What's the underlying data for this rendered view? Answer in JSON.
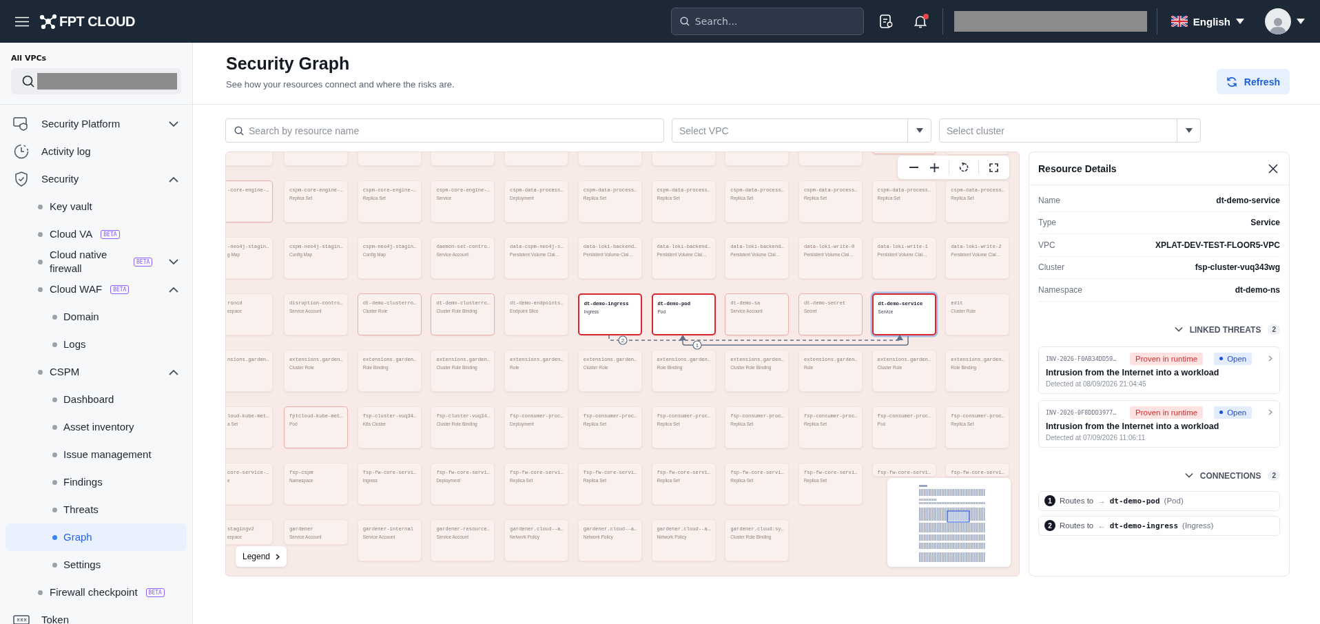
{
  "header": {
    "logo": "FPT CLOUD",
    "search": {
      "placeholder": "Search..."
    },
    "notifications": {
      "unread": true
    },
    "language": "English"
  },
  "sidebar": {
    "scope_label": "All VPCs",
    "items": [
      {
        "label": "Security Platform",
        "expanded": false,
        "selected": false
      },
      {
        "label": "Activity log",
        "selected": false
      },
      {
        "label": "Security",
        "expanded": true,
        "selected": false,
        "children": [
          {
            "label": "Key vault",
            "selected": false
          },
          {
            "label": "Cloud VA",
            "badge": "BETA",
            "selected": false
          },
          {
            "label": "Cloud native firewall",
            "badge": "BETA",
            "expanded": false,
            "selected": false
          },
          {
            "label": "Cloud WAF",
            "badge": "BETA",
            "expanded": true,
            "selected": false,
            "children": [
              {
                "label": "Domain",
                "selected": false
              },
              {
                "label": "Logs",
                "selected": false
              }
            ]
          },
          {
            "label": "CSPM",
            "expanded": true,
            "selected": false,
            "children": [
              {
                "label": "Dashboard",
                "selected": false
              },
              {
                "label": "Asset inventory",
                "selected": false
              },
              {
                "label": "Issue management",
                "selected": false
              },
              {
                "label": "Findings",
                "selected": false
              },
              {
                "label": "Threats",
                "selected": false
              },
              {
                "label": "Graph",
                "selected": true
              },
              {
                "label": "Settings",
                "selected": false
              }
            ]
          },
          {
            "label": "Firewall checkpoint",
            "badge": "BETA",
            "selected": false
          }
        ]
      },
      {
        "label": "Token",
        "selected": false
      }
    ]
  },
  "page": {
    "title": "Security Graph",
    "subtitle": "See how your resources connect and where the risks are.",
    "refresh": "Refresh"
  },
  "filters": {
    "search": {
      "placeholder": "Search by resource name"
    },
    "vpc": {
      "placeholder": "Select VPC"
    },
    "cluster": {
      "placeholder": "Select cluster"
    }
  },
  "graph": {
    "rows": [
      {
        "nodes": [
          {
            "risk": false,
            "in_path": false,
            "selected": false
          },
          {
            "risk": false,
            "in_path": false,
            "selected": false
          },
          {
            "risk": false,
            "in_path": false,
            "selected": false
          },
          {
            "risk": false,
            "in_path": false,
            "selected": false
          },
          {
            "risk": false,
            "in_path": false,
            "selected": false
          },
          {
            "risk": false,
            "in_path": false,
            "selected": false
          },
          {
            "risk": false,
            "in_path": false,
            "selected": false
          },
          {
            "risk": false,
            "in_path": false,
            "selected": false
          },
          {
            "risk": false,
            "in_path": false,
            "selected": false
          },
          {
            "risk": true,
            "in_path": false,
            "selected": false
          },
          {
            "risk": false,
            "in_path": false,
            "selected": false
          }
        ]
      },
      {
        "nodes": [
          {
            "name": "-core-engine-…",
            "risk": true,
            "in_path": false,
            "selected": false
          },
          {
            "name": "cspm-core-engine-…",
            "type": "Replica Set",
            "risk": false,
            "in_path": false,
            "selected": false
          },
          {
            "name": "cspm-core-engine-…",
            "type": "Replica Set",
            "risk": false,
            "in_path": false,
            "selected": false
          },
          {
            "name": "cspm-core-engine-…",
            "type": "Service",
            "risk": false,
            "in_path": false,
            "selected": false
          },
          {
            "name": "cspm-data-process…",
            "type": "Deployment",
            "risk": false,
            "in_path": false,
            "selected": false
          },
          {
            "name": "cspm-data-process…",
            "type": "Replica Set",
            "risk": false,
            "in_path": false,
            "selected": false
          },
          {
            "name": "cspm-data-process…",
            "type": "Replica Set",
            "risk": false,
            "in_path": false,
            "selected": false
          },
          {
            "name": "cspm-data-process…",
            "type": "Replica Set",
            "risk": false,
            "in_path": false,
            "selected": false
          },
          {
            "name": "cspm-data-process…",
            "type": "Replica Set",
            "risk": false,
            "in_path": false,
            "selected": false
          },
          {
            "name": "cspm-data-process…",
            "type": "Replica Set",
            "risk": false,
            "in_path": false,
            "selected": false
          },
          {
            "name": "cspm-data-process…",
            "type": "Replica Set",
            "risk": false,
            "in_path": false,
            "selected": false
          }
        ]
      },
      {
        "nodes": [
          {
            "name": "-neo4j-stagin…",
            "type": "g Map",
            "risk": false,
            "in_path": false,
            "selected": false
          },
          {
            "name": "cspm-neo4j-stagin…",
            "type": "Config Map",
            "risk": false,
            "in_path": false,
            "selected": false
          },
          {
            "name": "cspm-neo4j-stagin…",
            "type": "Config Map",
            "risk": false,
            "in_path": false,
            "selected": false
          },
          {
            "name": "daemon-set-contro…",
            "type": "Service Account",
            "risk": false,
            "in_path": false,
            "selected": false
          },
          {
            "name": "data-cspm-neo4j-s…",
            "type": "Persistent Volume Clai…",
            "risk": false,
            "in_path": false,
            "selected": false
          },
          {
            "name": "data-loki-backend…",
            "type": "Persistent Volume Clai…",
            "risk": false,
            "in_path": false,
            "selected": false
          },
          {
            "name": "data-loki-backend…",
            "type": "Persistent Volume Clai…",
            "risk": false,
            "in_path": false,
            "selected": false
          },
          {
            "name": "data-loki-backend…",
            "type": "Persistent Volume Clai…",
            "risk": false,
            "in_path": false,
            "selected": false
          },
          {
            "name": "data-loki-write-0",
            "type": "Persistent Volume Clai…",
            "risk": false,
            "in_path": false,
            "selected": false
          },
          {
            "name": "data-loki-write-1",
            "type": "Persistent Volume Clai…",
            "risk": false,
            "in_path": false,
            "selected": false
          },
          {
            "name": "data-loki-write-2",
            "type": "Persistent Volume Clai…",
            "risk": false,
            "in_path": false,
            "selected": false
          }
        ]
      },
      {
        "nodes": [
          {
            "name": "roncd",
            "type": "espace",
            "risk": false,
            "in_path": false,
            "selected": false
          },
          {
            "name": "disruption-contro…",
            "type": "Service Account",
            "risk": false,
            "in_path": false,
            "selected": false
          },
          {
            "name": "dt-demo-clusterro…",
            "type": "Cluster Role",
            "risk": true,
            "in_path": false,
            "selected": false
          },
          {
            "name": "dt-demo-clusterro…",
            "type": "Cluster Role Binding",
            "risk": true,
            "in_path": false,
            "selected": false
          },
          {
            "name": "dt-demo-endpoints…",
            "type": "Endpoint Slice",
            "risk": false,
            "in_path": false,
            "selected": false
          },
          {
            "name": "dt-demo-ingress",
            "type": "Ingress",
            "risk": true,
            "in_path": true,
            "selected": false
          },
          {
            "name": "dt-demo-pod",
            "type": "Pod",
            "risk": true,
            "in_path": true,
            "selected": false
          },
          {
            "name": "dt-demo-sa",
            "type": "Service Account",
            "risk": true,
            "in_path": false,
            "selected": false
          },
          {
            "name": "dt-demo-secret",
            "type": "Secret",
            "risk": true,
            "in_path": false,
            "selected": false
          },
          {
            "name": "dt-demo-service",
            "type": "Service",
            "risk": true,
            "in_path": true,
            "selected": true
          },
          {
            "name": "edit",
            "type": "Cluster Role",
            "risk": false,
            "in_path": false,
            "selected": false
          }
        ]
      },
      {
        "nodes": [
          {
            "name": "nsions.garden…",
            "risk": false,
            "in_path": false,
            "selected": false
          },
          {
            "name": "extensions.garden…",
            "type": "Cluster Role",
            "risk": false,
            "in_path": false,
            "selected": false
          },
          {
            "name": "extensions.garden…",
            "type": "Role Binding",
            "risk": false,
            "in_path": false,
            "selected": false
          },
          {
            "name": "extensions.garden…",
            "type": "Cluster Role Binding",
            "risk": false,
            "in_path": false,
            "selected": false
          },
          {
            "name": "extensions.garden…",
            "type": "Role",
            "risk": false,
            "in_path": false,
            "selected": false
          },
          {
            "name": "extensions.garden…",
            "type": "Cluster Role",
            "risk": false,
            "in_path": false,
            "selected": false
          },
          {
            "name": "extensions.garden…",
            "type": "Role Binding",
            "risk": false,
            "in_path": false,
            "selected": false
          },
          {
            "name": "extensions.garden…",
            "type": "Cluster Role Binding",
            "risk": false,
            "in_path": false,
            "selected": false
          },
          {
            "name": "extensions.garden…",
            "type": "Role",
            "risk": false,
            "in_path": false,
            "selected": false
          },
          {
            "name": "extensions.garden…",
            "type": "Cluster Role",
            "risk": false,
            "in_path": false,
            "selected": false
          },
          {
            "name": "extensions.garden…",
            "type": "Role Binding",
            "risk": false,
            "in_path": false,
            "selected": false
          }
        ]
      },
      {
        "nodes": [
          {
            "name": "loud-kube-met…",
            "type": "a Set",
            "risk": false,
            "in_path": false,
            "selected": false
          },
          {
            "name": "fptcloud-kube-met…",
            "type": "Pod",
            "risk": true,
            "in_path": false,
            "selected": false
          },
          {
            "name": "fsp-cluster-vuq34…",
            "type": "K8s Cluster",
            "risk": false,
            "in_path": false,
            "selected": false
          },
          {
            "name": "fsp-cluster-vuq34…",
            "type": "Cluster Role Binding",
            "risk": false,
            "in_path": false,
            "selected": false
          },
          {
            "name": "fsp-consumer-proc…",
            "type": "Deployment",
            "risk": false,
            "in_path": false,
            "selected": false
          },
          {
            "name": "fsp-consumer-proc…",
            "type": "Replica Set",
            "risk": false,
            "in_path": false,
            "selected": false
          },
          {
            "name": "fsp-consumer-proc…",
            "type": "Replica Set",
            "risk": false,
            "in_path": false,
            "selected": false
          },
          {
            "name": "fsp-consumer-proc…",
            "type": "Replica Set",
            "risk": false,
            "in_path": false,
            "selected": false
          },
          {
            "name": "fsp-consumer-proc…",
            "type": "Replica Set",
            "risk": false,
            "in_path": false,
            "selected": false
          },
          {
            "name": "fsp-consumer-proc…",
            "type": "Pod",
            "risk": false,
            "in_path": false,
            "selected": false
          },
          {
            "name": "fsp-consumer-proc…",
            "type": "Replica Set",
            "risk": false,
            "in_path": false,
            "selected": false
          }
        ]
      },
      {
        "nodes": [
          {
            "name": "core-service-…",
            "type": "e",
            "risk": false,
            "in_path": false,
            "selected": false
          },
          {
            "name": "fsp-cspm",
            "type": "Namespace",
            "risk": false,
            "in_path": false,
            "selected": false
          },
          {
            "name": "fsp-fw-core-servi…",
            "type": "Ingress",
            "risk": false,
            "in_path": false,
            "selected": false
          },
          {
            "name": "fsp-fw-core-servi…",
            "type": "Deployment",
            "risk": false,
            "in_path": false,
            "selected": false
          },
          {
            "name": "fsp-fw-core-servi…",
            "type": "Replica Set",
            "risk": false,
            "in_path": false,
            "selected": false
          },
          {
            "name": "fsp-fw-core-servi…",
            "type": "Replica Set",
            "risk": false,
            "in_path": false,
            "selected": false
          },
          {
            "name": "fsp-fw-core-servi…",
            "type": "Replica Set",
            "risk": false,
            "in_path": false,
            "selected": false
          },
          {
            "name": "fsp-fw-core-servi…",
            "type": "Replica Set",
            "risk": false,
            "in_path": false,
            "selected": false
          },
          {
            "name": "fsp-fw-core-servi…",
            "type": "Replica Set",
            "risk": false,
            "in_path": false,
            "selected": false
          },
          {
            "name": "fsp-fw-core-servi…",
            "risk": false,
            "in_path": false,
            "selected": false
          },
          {
            "name": "fsp-fw-core-servi…",
            "risk": false,
            "in_path": false,
            "selected": false
          }
        ]
      },
      {
        "nodes": [
          {
            "name": "stagingv2",
            "type": "espace",
            "risk": false,
            "in_path": false,
            "selected": false
          },
          {
            "name": "gardener",
            "type": "Service Account",
            "risk": false,
            "in_path": false,
            "selected": false
          },
          {
            "name": "gardener-internal",
            "type": "Service Account",
            "risk": false,
            "in_path": false,
            "selected": false
          },
          {
            "name": "gardener-resource…",
            "type": "Service Account",
            "risk": false,
            "in_path": false,
            "selected": false
          },
          {
            "name": "gardener.cloud--a…",
            "type": "Network Policy",
            "risk": false,
            "in_path": false,
            "selected": false
          },
          {
            "name": "gardener.cloud--a…",
            "type": "Network Policy",
            "risk": false,
            "in_path": false,
            "selected": false
          },
          {
            "name": "gardener.cloud--a…",
            "type": "Network Policy",
            "risk": false,
            "in_path": false,
            "selected": false
          },
          {
            "name": "gardener.cloud:sy…",
            "type": "Cluster Role Binding",
            "risk": false,
            "in_path": false,
            "selected": false
          }
        ]
      }
    ],
    "edges": [
      {
        "label": "1",
        "kind": "solid"
      },
      {
        "label": "2",
        "kind": "dashed"
      }
    ],
    "legend": "Legend"
  },
  "details": {
    "title": "Resource Details",
    "fields": [
      {
        "label": "Name",
        "value": "dt-demo-service"
      },
      {
        "label": "Type",
        "value": "Service"
      },
      {
        "label": "VPC",
        "value": "XPLAT-DEV-TEST-FLOOR5-VPC"
      },
      {
        "label": "Cluster",
        "value": "fsp-cluster-vuq343wg"
      },
      {
        "label": "Namespace",
        "value": "dt-demo-ns"
      }
    ],
    "threats": {
      "title": "LINKED THREATS",
      "count": "2",
      "expanded": true,
      "items": [
        {
          "id": "INV-2026-F0AB34DD59…",
          "evidence": "Proven in runtime",
          "status": "Open",
          "title": "Intrusion from the Internet into a workload",
          "detected": "Detected at 08/09/2026 21:04:45"
        },
        {
          "id": "INV-2026-0F8DDD3977…",
          "evidence": "Proven in runtime",
          "status": "Open",
          "title": "Intrusion from the Internet into a workload",
          "detected": "Detected at 07/09/2026 11:06:11"
        }
      ]
    },
    "connections": {
      "title": "CONNECTIONS",
      "count": "2",
      "expanded": true,
      "items": [
        {
          "number": "1",
          "verb": "Routes to",
          "arrow": "→",
          "target": "dt-demo-pod",
          "type": "(Pod)"
        },
        {
          "number": "2",
          "verb": "Routes to",
          "arrow": "←",
          "target": "dt-demo-ingress",
          "type": "(Ingress)"
        }
      ]
    }
  }
}
